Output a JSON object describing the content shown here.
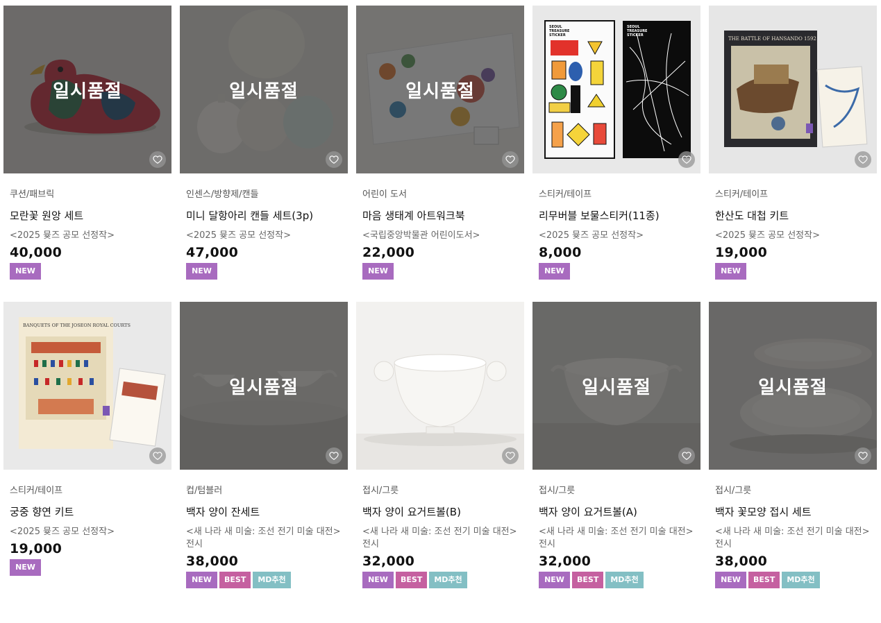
{
  "overlay_text": "일시품절",
  "products": [
    {
      "category": "쿠션/패브릭",
      "name": "모란꽃 원앙 세트",
      "subtitle": "<2025 뮺즈 공모 선정작>",
      "price": "40,000",
      "badges": [
        "NEW"
      ],
      "sold_out": true
    },
    {
      "category": "인센스/방향제/캔들",
      "name": "미니 달항아리 캔들 세트(3p)",
      "subtitle": "<2025 뮺즈 공모 선정작>",
      "price": "47,000",
      "badges": [
        "NEW"
      ],
      "sold_out": true
    },
    {
      "category": "어린이 도서",
      "name": "마음 생태계 아트워크북",
      "subtitle": "<국립중앙박물관 어린이도서>",
      "price": "22,000",
      "badges": [
        "NEW"
      ],
      "sold_out": true
    },
    {
      "category": "스티커/테이프",
      "name": "리무버블 보물스티커(11종)",
      "subtitle": "<2025 뮺즈 공모 선정작>",
      "price": "8,000",
      "badges": [
        "NEW"
      ],
      "sold_out": false
    },
    {
      "category": "스티커/테이프",
      "name": "한산도 대첩 키트",
      "subtitle": "<2025 뮺즈 공모 선정작>",
      "price": "19,000",
      "badges": [
        "NEW"
      ],
      "sold_out": false
    },
    {
      "category": "스티커/테이프",
      "name": "궁중 향연 키트",
      "subtitle": "<2025 뮺즈 공모 선정작>",
      "price": "19,000",
      "badges": [
        "NEW"
      ],
      "sold_out": false
    },
    {
      "category": "컵/텀블러",
      "name": "백자 양이 잔세트",
      "subtitle": "<새 나라 새 미술: 조선 전기 미술 대전> 전시",
      "price": "38,000",
      "badges": [
        "NEW",
        "BEST",
        "MD추천"
      ],
      "sold_out": true
    },
    {
      "category": "접시/그릇",
      "name": "백자 양이 요거트볼(B)",
      "subtitle": "<새 나라 새 미술: 조선 전기 미술 대전> 전시",
      "price": "32,000",
      "badges": [
        "NEW",
        "BEST",
        "MD추천"
      ],
      "sold_out": false
    },
    {
      "category": "접시/그릇",
      "name": "백자 양이 요거트볼(A)",
      "subtitle": "<새 나라 새 미술: 조선 전기 미술 대전> 전시",
      "price": "32,000",
      "badges": [
        "NEW",
        "BEST",
        "MD추천"
      ],
      "sold_out": true
    },
    {
      "category": "접시/그릇",
      "name": "백자 꽃모양 접시 세트",
      "subtitle": "<새 나라 새 미술: 조선 전기 미술 대전> 전시",
      "price": "38,000",
      "badges": [
        "NEW",
        "BEST",
        "MD추천"
      ],
      "sold_out": true
    }
  ],
  "sticker_labels": {
    "left": "SEOUL TREASURE STICKER",
    "right": "SEOUL TREASURE STICKER"
  },
  "kit_titles": {
    "hansando": "THE BATTLE OF HANSANDO 1592",
    "banquets": "BANQUETS OF THE JOSEON ROYAL COURTS"
  },
  "icons": {
    "wishlist": "heart-icon"
  },
  "colors": {
    "new": "#a86bbf",
    "best": "#c560a0",
    "md": "#83bfc4",
    "overlay": "#3a3a3a"
  }
}
